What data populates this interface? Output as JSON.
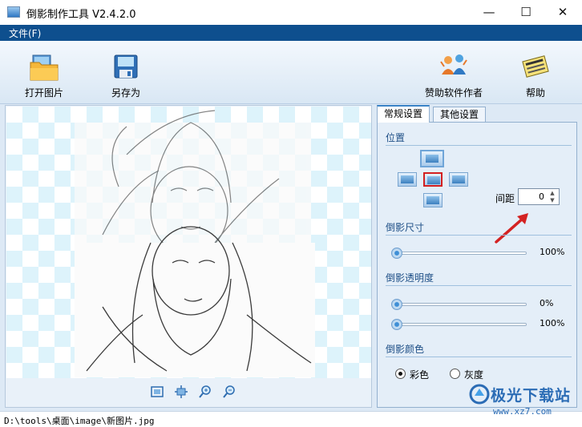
{
  "window": {
    "title": "倒影制作工具 V2.4.2.0",
    "controls": {
      "minimize": "—",
      "maximize": "☐",
      "close": "✕"
    }
  },
  "menu": {
    "items": [
      {
        "label": "文件(F)"
      }
    ]
  },
  "toolbar": {
    "open_label": "打开图片",
    "saveas_label": "另存为",
    "sponsor_label": "赞助软件作者",
    "help_label": "帮助"
  },
  "tabs": [
    {
      "label": "常规设置",
      "active": true
    },
    {
      "label": "其他设置",
      "active": false
    }
  ],
  "general": {
    "position": {
      "title": "位置",
      "spacing_label": "间距",
      "spacing_value": "0"
    },
    "size": {
      "title": "倒影尺寸",
      "value": "100%",
      "level": 0
    },
    "opacity": {
      "title": "倒影透明度",
      "start_value": "0%",
      "end_value": "100%",
      "start_level": 0,
      "end_level": 0
    },
    "color": {
      "title": "倒影颜色",
      "options": [
        {
          "label": "彩色",
          "checked": true
        },
        {
          "label": "灰度",
          "checked": false
        }
      ]
    }
  },
  "status": {
    "path": "D:\\tools\\桌面\\image\\新图片.jpg"
  },
  "watermark": {
    "brand": "极光下载站",
    "url": "www.xz7.com"
  },
  "colors": {
    "menubar": "#0e4f8e",
    "accent": "#3a83c6",
    "arrow": "#d42222"
  }
}
